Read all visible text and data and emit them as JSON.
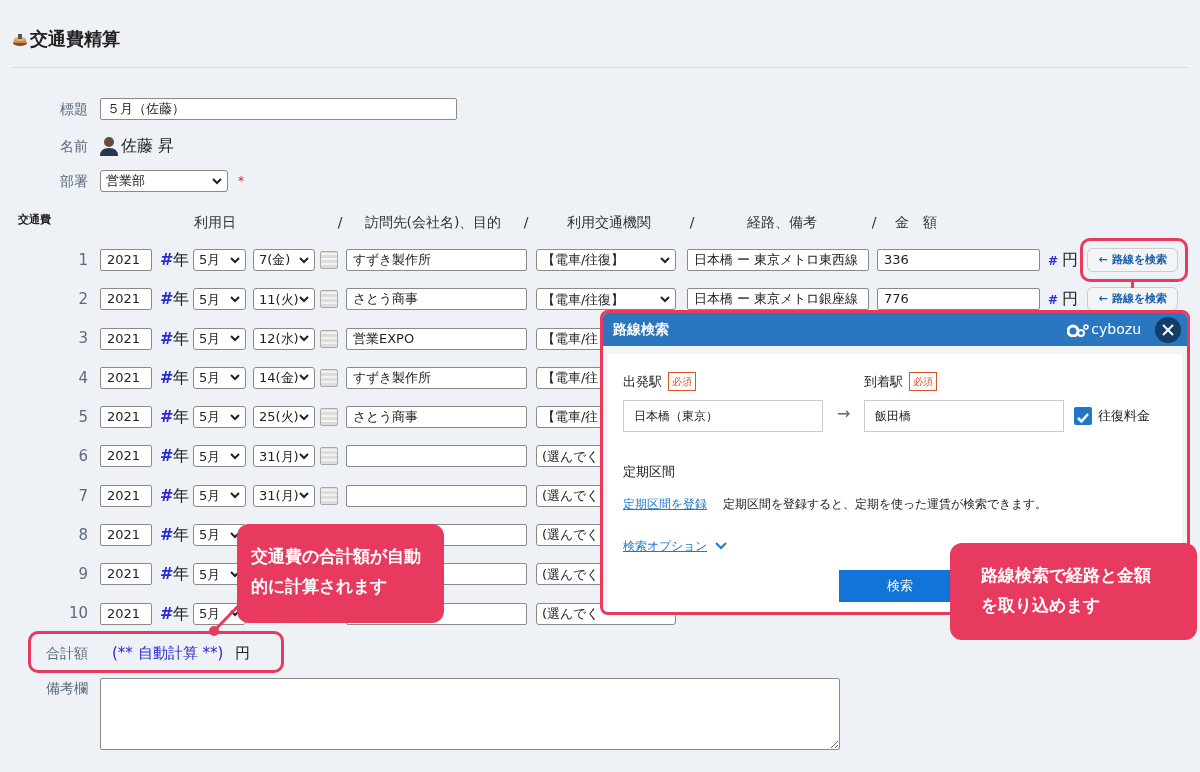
{
  "page": {
    "title": "交通費精算"
  },
  "form": {
    "subject_label": "標題",
    "subject": "５月（佐藤）",
    "name_label": "名前",
    "name": "佐藤 昇",
    "dept_label": "部署",
    "dept": "営業部",
    "required_mark": "*"
  },
  "expenses": {
    "label": "交通費",
    "headers": [
      "利用日",
      "/",
      "訪問先(会社名)、目的",
      "/",
      "利用交通機関",
      "/",
      "経路、備考",
      "/",
      "金　額"
    ],
    "rows": [
      {
        "no": "1",
        "year": "2021",
        "mark": "#",
        "year_unit": "年",
        "month": "5月",
        "day": "7(金)",
        "purpose": "すずき製作所",
        "transport": "【電車/往復】",
        "route": "日本橋 ー 東京メトロ東西線",
        "amount": "336",
        "yen_mark": "#",
        "yen_unit": "円",
        "button": "← 路線を検索"
      },
      {
        "no": "2",
        "year": "2021",
        "mark": "#",
        "year_unit": "年",
        "month": "5月",
        "day": "11(火)",
        "purpose": "さとう商事",
        "transport": "【電車/往復】",
        "route": "日本橋 ー 東京メトロ銀座線",
        "amount": "776",
        "yen_mark": "#",
        "yen_unit": "円",
        "button": "← 路線を検索"
      },
      {
        "no": "3",
        "year": "2021",
        "mark": "#",
        "year_unit": "年",
        "month": "5月",
        "day": "12(水)",
        "purpose": "営業EXPO",
        "transport": "【電車/往"
      },
      {
        "no": "4",
        "year": "2021",
        "mark": "#",
        "year_unit": "年",
        "month": "5月",
        "day": "14(金)",
        "purpose": "すずき製作所",
        "transport": "【電車/往"
      },
      {
        "no": "5",
        "year": "2021",
        "mark": "#",
        "year_unit": "年",
        "month": "5月",
        "day": "25(火)",
        "purpose": "さとう商事",
        "transport": "【電車/往"
      },
      {
        "no": "6",
        "year": "2021",
        "mark": "#",
        "year_unit": "年",
        "month": "5月",
        "day": "31(月)",
        "transport": "(選んでく"
      },
      {
        "no": "7",
        "year": "2021",
        "mark": "#",
        "year_unit": "年",
        "month": "5月",
        "day": "31(月)",
        "transport": "(選んでく"
      },
      {
        "no": "8",
        "year": "2021",
        "mark": "#",
        "year_unit": "年",
        "month": "5月",
        "transport": "(選んでく"
      },
      {
        "no": "9",
        "year": "2021",
        "mark": "#",
        "year_unit": "年",
        "month": "5月",
        "transport": "(選んでく"
      },
      {
        "no": "10",
        "year": "2021",
        "mark": "#",
        "year_unit": "年",
        "month": "5月",
        "transport": "(選んでく"
      }
    ]
  },
  "total": {
    "label": "合計額",
    "value": "(** 自動計算 **)",
    "unit": "円"
  },
  "notes": {
    "label": "備考欄"
  },
  "dialog": {
    "title": "路線検索",
    "brand": "cybozu",
    "from_label": "出発駅",
    "from_badge": "必須",
    "from": "日本橋（東京）",
    "arrow": "→",
    "to_label": "到着駅",
    "to_badge": "必須",
    "to": "飯田橋",
    "round_trip": {
      "label": "往復料金",
      "checked": true
    },
    "commuter_heading": "定期区間",
    "commuter_link": "定期区間を登録",
    "commuter_text": "定期区間を登録すると、定期を使った運賃が検索できます。",
    "options_link": "検索オプション",
    "search_button": "検索"
  },
  "callouts": [
    {
      "text": "交通費の合計額が自動的に計算されます"
    },
    {
      "text": "路線検索で経路と金額を取り込めます"
    }
  ]
}
